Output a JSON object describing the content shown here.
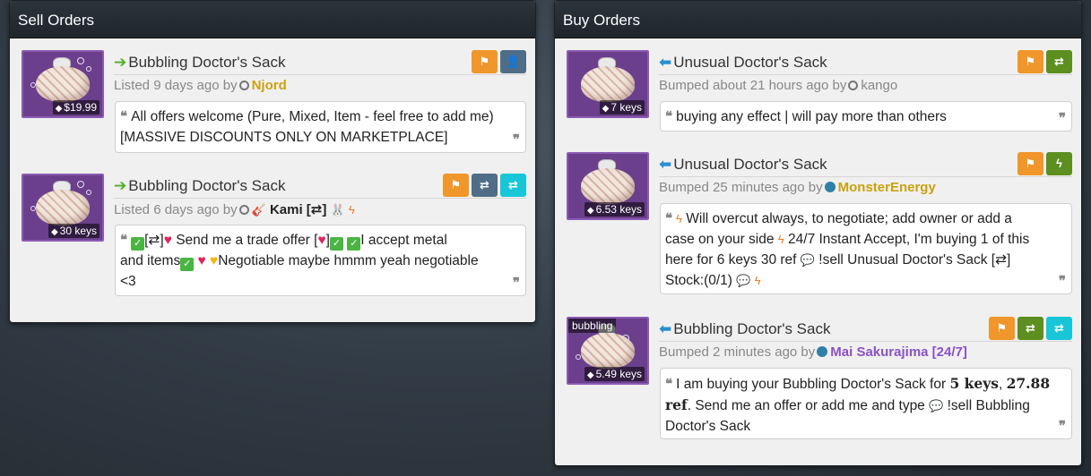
{
  "sell": {
    "header": "Sell Orders",
    "orders": [
      {
        "title": "Bubbling Doctor's Sack",
        "price": "$19.99",
        "meta_prefix": "Listed 9 days ago by",
        "user": "Njord",
        "comment_l1": "All offers welcome (Pure, Mixed, Item - feel free to add me)",
        "comment_l2": "[MASSIVE DISCOUNTS ONLY ON MARKETPLACE]"
      },
      {
        "title": "Bubbling Doctor's Sack",
        "price": "30 keys",
        "meta_prefix": "Listed 6 days ago by",
        "user": "Kami [⇄]",
        "comment_p1": "[⇄]",
        "comment_p2": "Send me a trade offer [",
        "comment_p3": "]",
        "comment_p4": "I accept metal",
        "comment_p5": "and items",
        "comment_p6": "Negotiable maybe hmmm yeah negotiable",
        "comment_p7": "<3"
      }
    ]
  },
  "buy": {
    "header": "Buy Orders",
    "orders": [
      {
        "title": "Unusual Doctor's Sack",
        "price": "7 keys",
        "meta_prefix": "Bumped about 21 hours ago by",
        "user": "kango",
        "comment": "buying any effect | will pay more than others"
      },
      {
        "title": "Unusual Doctor's Sack",
        "price": "6.53 keys",
        "meta_prefix": "Bumped 25 minutes ago by",
        "user": "MonsterEnergy",
        "comment_p1": "Will overcut always, to negotiate; add owner or add a",
        "comment_p2": "case on your side",
        "comment_p3": "24/7 Instant Accept, I'm buying 1 of this",
        "comment_p4": "here for 6 keys 30 ref",
        "comment_p5": "!sell Unusual Doctor's Sack [⇄]",
        "comment_p6": "Stock:(0/1)"
      },
      {
        "title": "Bubbling Doctor's Sack",
        "price": "5.49 keys",
        "effect_label": "bubbling",
        "meta_prefix": "Bumped 2 minutes ago by",
        "user": "Mai Sakurajima [24/7]",
        "comment_p1": "I am buying your Bubbling Doctor's Sack for",
        "comment_bold1": "5 keys",
        "comment_sep": ",",
        "comment_bold2": "27.88",
        "comment_bold3": "ref",
        "comment_p2": ". Send me an offer or add me and type",
        "comment_p3": "!sell Bubbling",
        "comment_p4": "Doctor's Sack"
      }
    ]
  },
  "icons": {
    "flag": "⚑",
    "add_user": "+",
    "trade": "⇄",
    "bolt": "ϟ",
    "tag": "🏷",
    "quote_open": "❝",
    "quote_close": "❞",
    "check": "✓"
  },
  "colors": {
    "orange_btn": "#f0962b",
    "slate_btn": "#4f6d86",
    "green_btn": "#5c8f1f",
    "cyan_btn": "#18c6d8",
    "sell_arrow": "#4caf25",
    "buy_arrow": "#2a8fd1"
  }
}
